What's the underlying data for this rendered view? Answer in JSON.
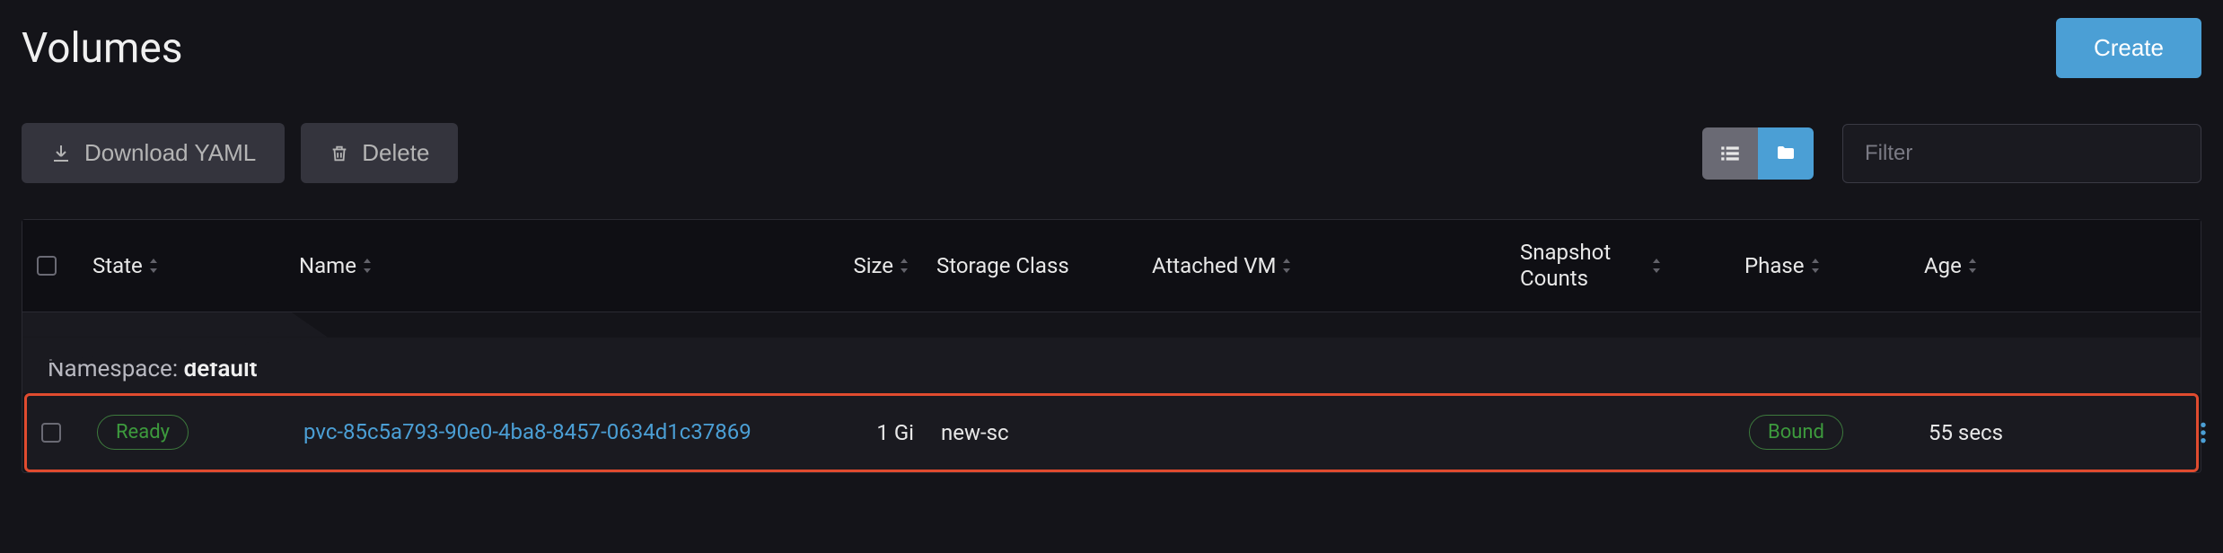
{
  "page_title": "Volumes",
  "buttons": {
    "create": "Create",
    "download_yaml": "Download YAML",
    "delete": "Delete"
  },
  "filter": {
    "placeholder": "Filter"
  },
  "columns": {
    "state": "State",
    "name": "Name",
    "size": "Size",
    "storage_class": "Storage Class",
    "attached_vm": "Attached VM",
    "snapshot_counts": "Snapshot Counts",
    "phase": "Phase",
    "age": "Age"
  },
  "group": {
    "label": "Namespace: ",
    "value": "default"
  },
  "rows": [
    {
      "state": "Ready",
      "name": "pvc-85c5a793-90e0-4ba8-8457-0634d1c37869",
      "size": "1 Gi",
      "storage_class": "new-sc",
      "attached_vm": "",
      "snapshot_counts": "",
      "phase": "Bound",
      "age": "55 secs"
    }
  ]
}
